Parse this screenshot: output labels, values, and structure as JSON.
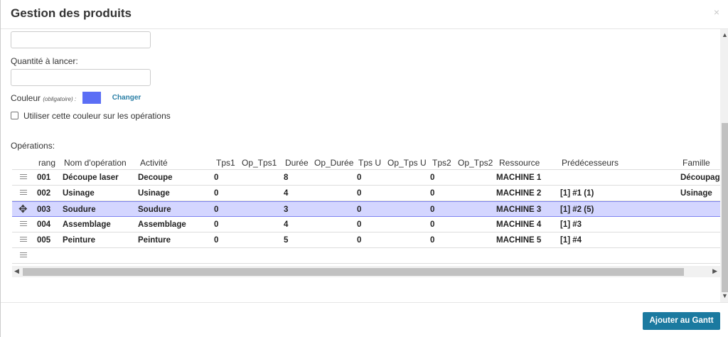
{
  "modal": {
    "title": "Gestion des produits",
    "close_glyph": "×"
  },
  "form": {
    "top_input_value": "",
    "quantity_label": "Quantité à lancer:",
    "quantity_value": "",
    "color_label": "Couleur",
    "color_hint": "(obligatoire) :",
    "color_value": "#5b6ef5",
    "change_label": "Changer",
    "checkbox_label": "Utiliser cette couleur sur les opérations",
    "checkbox_checked": false,
    "operations_label": "Opérations:"
  },
  "table": {
    "columns": [
      "rang",
      "Nom d'opération",
      "Activité",
      "Tps1",
      "Op_Tps1",
      "Durée",
      "Op_Durée",
      "Tps U",
      "Op_Tps U",
      "Tps2",
      "Op_Tps2",
      "Ressource",
      "Prédécesseurs",
      "Famille"
    ],
    "rows": [
      {
        "rang": "001",
        "nom": "Découpe laser",
        "activite": "Decoupe",
        "tps1": "0",
        "duree": "8",
        "tpsu": "0",
        "tps2": "0",
        "ressource": "MACHINE 1",
        "pred": "",
        "famille": "Découpag"
      },
      {
        "rang": "002",
        "nom": "Usinage",
        "activite": "Usinage",
        "tps1": "0",
        "duree": "4",
        "tpsu": "0",
        "tps2": "0",
        "ressource": "MACHINE 2",
        "pred": "[1] #1 (1)",
        "famille": "Usinage"
      },
      {
        "rang": "003",
        "nom": "Soudure",
        "activite": "Soudure",
        "tps1": "0",
        "duree": "3",
        "tpsu": "0",
        "tps2": "0",
        "ressource": "MACHINE 3",
        "pred": "[1] #2 (5)",
        "famille": ""
      },
      {
        "rang": "004",
        "nom": "Assemblage",
        "activite": "Assemblage",
        "tps1": "0",
        "duree": "4",
        "tpsu": "0",
        "tps2": "0",
        "ressource": "MACHINE 4",
        "pred": "[1] #3",
        "famille": ""
      },
      {
        "rang": "005",
        "nom": "Peinture",
        "activite": "Peinture",
        "tps1": "0",
        "duree": "5",
        "tpsu": "0",
        "tps2": "0",
        "ressource": "MACHINE 5",
        "pred": "[1] #4",
        "famille": ""
      }
    ]
  },
  "footer": {
    "submit_label": "Ajouter au Gantt"
  },
  "colors": {
    "accent": "#1b7aa0",
    "selection": "#d4d6ff",
    "swatch": "#5b6ef5"
  }
}
